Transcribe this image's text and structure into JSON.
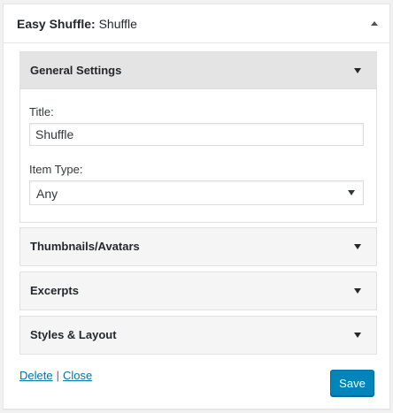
{
  "widget": {
    "title": "Easy Shuffle:",
    "in_title": "Shuffle"
  },
  "sections": {
    "general": {
      "label": "General Settings",
      "expanded": true
    },
    "thumbnails": {
      "label": "Thumbnails/Avatars",
      "expanded": false
    },
    "excerpts": {
      "label": "Excerpts",
      "expanded": false
    },
    "styles": {
      "label": "Styles & Layout",
      "expanded": false
    }
  },
  "form": {
    "title_label": "Title:",
    "title_value": "Shuffle",
    "item_type_label": "Item Type:",
    "item_type_value": "Any"
  },
  "footer": {
    "delete_label": "Delete",
    "separator": "|",
    "close_label": "Close",
    "save_label": "Save"
  },
  "colors": {
    "accent": "#0085ba",
    "link": "#0073aa",
    "panel_header": "#e4e4e4"
  },
  "icons": {
    "widget_toggle": "triangle-up-icon",
    "section_toggle": "triangle-down-icon",
    "select": "triangle-down-icon"
  }
}
